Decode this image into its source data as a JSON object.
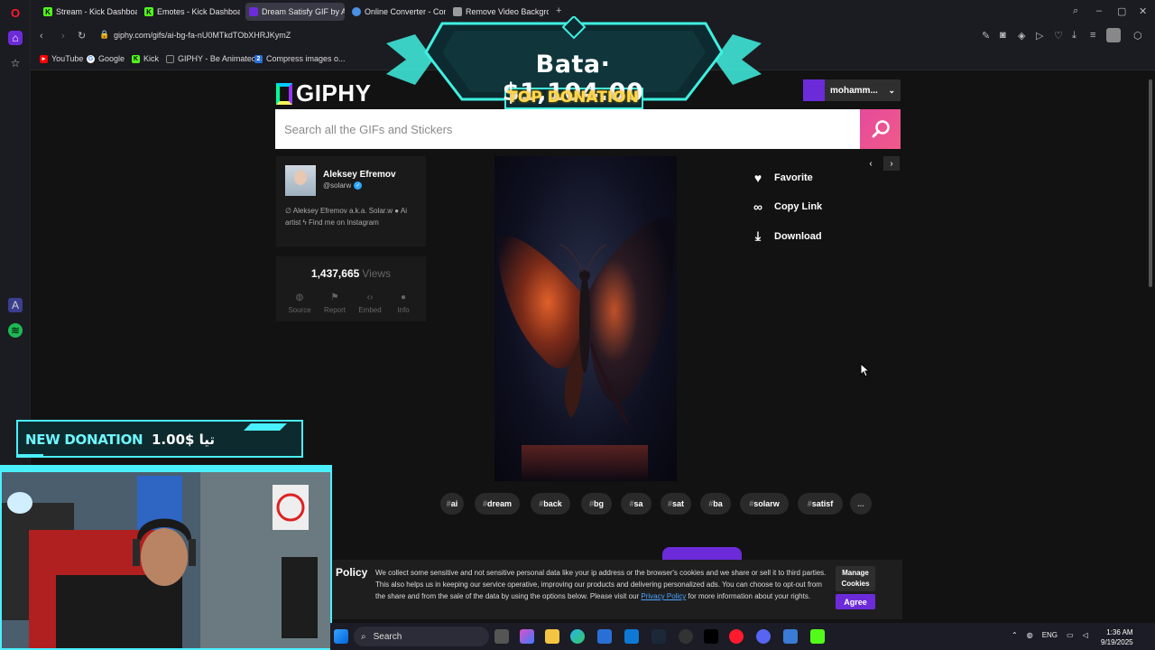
{
  "browser": {
    "tabs": [
      {
        "label": "Stream - Kick Dashboard",
        "fav_color": "#53fc18",
        "fav_glyph": "K"
      },
      {
        "label": "Emotes - Kick Dashboard",
        "fav_color": "#53fc18",
        "fav_glyph": "K"
      },
      {
        "label": "Dream Satisfy GIF by Alek",
        "fav_color": "#6c2bd9",
        "fav_glyph": ""
      },
      {
        "label": "Online Converter - Conve",
        "fav_color": "#4a90e2",
        "fav_glyph": ""
      },
      {
        "label": "Remove Video Backgroun",
        "fav_color": "#9b9b9b",
        "fav_glyph": ""
      }
    ],
    "url": "giphy.com/gifs/ai-bg-fa-nU0MTkdTObXHRJKymZ",
    "bookmarks": [
      {
        "label": "YouTube",
        "color": "#ff0000"
      },
      {
        "label": "Google",
        "color": "#4285f4"
      },
      {
        "label": "Kick",
        "color": "#53fc18"
      },
      {
        "label": "GIPHY - Be Animated",
        "color": "#222222"
      },
      {
        "label": "Compress images o...",
        "color": "#2a6fd6"
      }
    ]
  },
  "giphy": {
    "logo": "GIPHY",
    "username": "mohamm...",
    "search_placeholder": "Search all the GIFs and Stickers",
    "creator": {
      "name": "Aleksey Efremov",
      "handle": "@solarw",
      "bio": "∅ Aleksey Efremov a.k.a. Solar.w ● Ai artist ϟ Find me on Instagram"
    },
    "views": "1,437,665",
    "views_label": "Views",
    "stat_actions": [
      {
        "label": "Source",
        "icon": "◍"
      },
      {
        "label": "Report",
        "icon": "⚑"
      },
      {
        "label": "Embed",
        "icon": "‹›"
      },
      {
        "label": "Info",
        "icon": "●"
      }
    ],
    "side_actions": [
      {
        "label": "Favorite",
        "icon": "♥"
      },
      {
        "label": "Copy Link",
        "icon": "∞"
      },
      {
        "label": "Download",
        "icon": "⤓"
      }
    ],
    "tags": [
      "ai",
      "dream",
      "back",
      "bg",
      "sa",
      "sat",
      "ba",
      "solarw",
      "satisf"
    ],
    "tags_more": "..."
  },
  "cookie": {
    "title": "Policy",
    "text_before": "We collect some sensitive and not sensitive personal data like your ip address or the browser's cookies and we share or sell it to third parties. This also helps us in keeping our service operative, improving our products and delivering personalized ads. You can choose to opt-out from the share and from the sale of the data by using the options below. Please visit our ",
    "link": "Privacy Policy",
    "text_after": " for more information about your rights.",
    "manage_label": "Manage Cookies",
    "agree_label": "Agree"
  },
  "overlay": {
    "top_donation_amount": "Bata· $1,104.00",
    "top_donation_label": "TOP DONATION",
    "new_donation_label": "NEW DONATION",
    "new_donation_amount": "1.00$ تيا"
  },
  "taskbar": {
    "search": "Search",
    "lang": "ENG",
    "time": "1:36 AM",
    "date": "9/19/2025"
  },
  "colors": {
    "giphy_pink": "#e64a9b",
    "giphy_purple": "#6c2bd9",
    "overlay_cyan": "#4af0ff"
  }
}
